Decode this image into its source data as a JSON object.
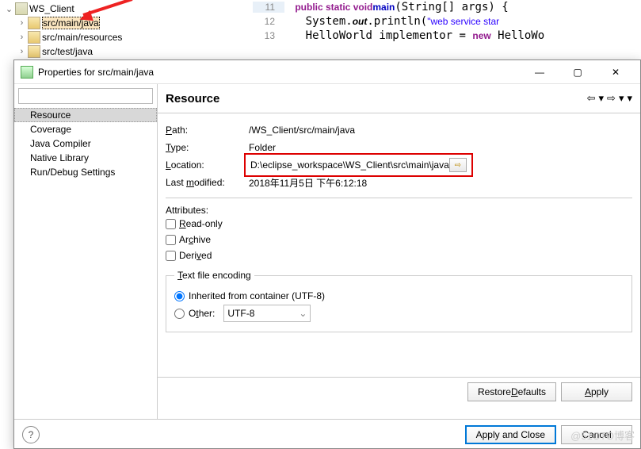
{
  "tree": {
    "project": "WS_Client",
    "nodes": [
      "src/main/java",
      "src/main/resources",
      "src/test/java"
    ]
  },
  "code": {
    "lines": [
      {
        "n": "11",
        "pre": "    ",
        "t": [
          [
            "kw-p",
            "public static void"
          ],
          [
            "",
            " "
          ],
          [
            "kw-b",
            "main"
          ],
          [
            "",
            "(String[] args) {"
          ]
        ]
      },
      {
        "n": "12",
        "pre": "        ",
        "t": [
          [
            "",
            "System."
          ],
          [
            "kw-b mth",
            "out"
          ],
          [
            "",
            ".println("
          ],
          [
            "str",
            "\"web service star"
          ]
        ]
      },
      {
        "n": "13",
        "pre": "        ",
        "t": [
          [
            "",
            "HelloWorld "
          ],
          [
            "",
            "implementor"
          ],
          [
            "",
            " = "
          ],
          [
            "kw-p",
            "new"
          ],
          [
            "",
            " HelloWo"
          ]
        ]
      }
    ]
  },
  "dialog": {
    "title": "Properties for src/main/java",
    "nav": [
      "Resource",
      "Coverage",
      "Java Compiler",
      "Native Library",
      "Run/Debug Settings"
    ],
    "header": "Resource",
    "path": {
      "label": "Path:",
      "value": "/WS_Client/src/main/java"
    },
    "type": {
      "label": "Type:",
      "value": "Folder"
    },
    "location": {
      "label": "Location:",
      "value": "D:\\eclipse_workspace\\WS_Client\\src\\main\\java"
    },
    "modified": {
      "label": "Last modified:",
      "value": "2018年11月5日 下午6:12:18"
    },
    "attrs_label": "Attributes:",
    "checks": {
      "readonly": "Read-only",
      "archive": "Archive",
      "derived": "Derived"
    },
    "enc": {
      "legend": "Text file encoding",
      "inherited": "Inherited from container (UTF-8)",
      "other": "Other:",
      "combo": "UTF-8"
    },
    "buttons": {
      "restore": "Restore Defaults",
      "apply": "Apply",
      "apply_close": "Apply and Close",
      "cancel": "Cancel"
    }
  },
  "watermark": "@51CTO博客"
}
